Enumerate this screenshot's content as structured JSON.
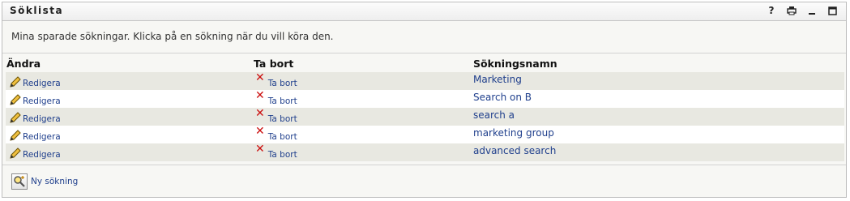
{
  "portlet": {
    "title": "Söklista",
    "tools": [
      {
        "icon": "help-icon",
        "glyph": "?"
      },
      {
        "icon": "print-icon",
        "glyph": "▤"
      },
      {
        "icon": "minimize-icon",
        "glyph": "_"
      },
      {
        "icon": "maximize-icon",
        "glyph": "□"
      }
    ]
  },
  "intro": "Mina sparade sökningar. Klicka på en sökning när du vill köra den.",
  "table": {
    "headers": {
      "edit": "Ändra",
      "delete": "Ta bort",
      "name": "Sökningsnamn"
    },
    "rows": [
      {
        "edit": "Redigera",
        "delete": "Ta bort",
        "name": "Marketing"
      },
      {
        "edit": "Redigera",
        "delete": "Ta bort",
        "name": "Search on B"
      },
      {
        "edit": "Redigera",
        "delete": "Ta bort",
        "name": "search a"
      },
      {
        "edit": "Redigera",
        "delete": "Ta bort",
        "name": "marketing group"
      },
      {
        "edit": "Redigera",
        "delete": "Ta bort",
        "name": "advanced search"
      }
    ]
  },
  "new_search": {
    "label": "Ny sökning",
    "icon": "new-search-magnifier-icon"
  },
  "colors": {
    "link": "#1f3f8c",
    "delete_icon": "#cc1111",
    "row_alt": "#e8e8e1"
  }
}
